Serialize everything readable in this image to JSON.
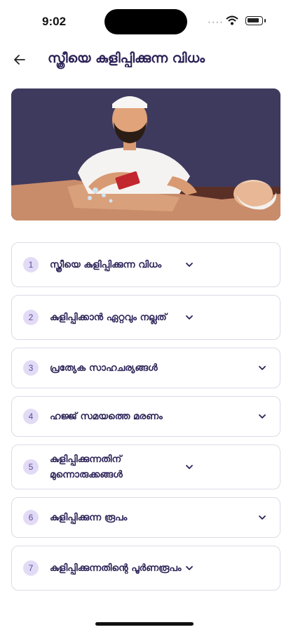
{
  "status": {
    "time": "9:02"
  },
  "header": {
    "title": "സ്ത്രീയെ കുളിപ്പിക്കുന്ന വിധം"
  },
  "sections": [
    {
      "number": "1",
      "title": "സ്ത്രീയെ കുളിപ്പിക്കുന്ന വിധം"
    },
    {
      "number": "2",
      "title": "കുളിപ്പിക്കാൻ ഏറ്റവും നല്ലത്"
    },
    {
      "number": "3",
      "title": "പ്രത്യേക സാഹചര്യങ്ങൾ"
    },
    {
      "number": "4",
      "title": "ഹജ്ജ് സമയത്തെ മരണം"
    },
    {
      "number": "5",
      "title": "കുളിപ്പിക്കുന്നതിന് മുന്നൊരുക്കങ്ങൾ"
    },
    {
      "number": "6",
      "title": "കുളിപ്പിക്കുന്ന രൂപം"
    },
    {
      "number": "7",
      "title": "കുളിപ്പിക്കുന്നതിന്റെ പൂർണരൂപം"
    }
  ],
  "colors": {
    "accent": "#2b2156",
    "badge_bg": "#e3dbf6",
    "hero_bg": "#3e3a5e"
  },
  "icons": {
    "back": "arrow-left-icon",
    "expand": "chevron-down-icon"
  }
}
